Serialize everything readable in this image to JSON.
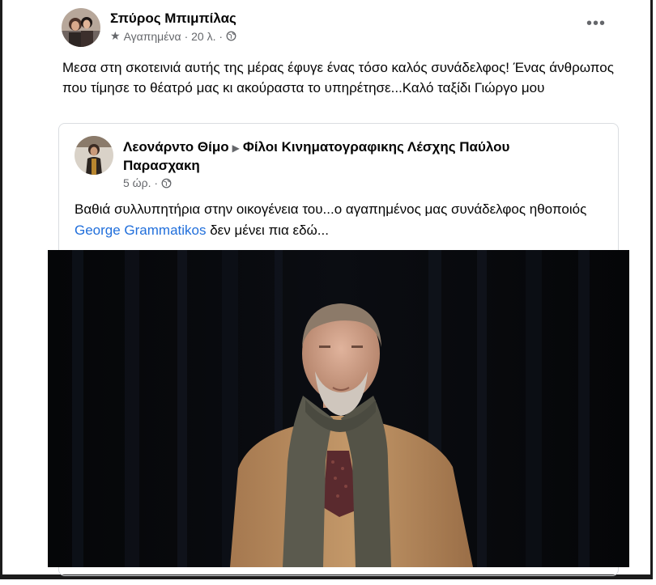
{
  "post": {
    "author": "Σπύρος Μπιμπίλας",
    "audience": "Αγαπημένα",
    "time": "· 20 λ. ·",
    "more_label": "•••",
    "text": "Μεσα στη σκοτεινιά αυτής της μέρας έφυγε ένας τόσο καλός συνάδελφος! Ένας άνθρωπος που τίμησε το θέατρό μας  κι ακούραστα το υπηρέτησε...Καλό ταξίδι Γιώργο μου"
  },
  "shared": {
    "author": "Λεονάρντο Θίμο",
    "group": "Φίλοι Κινηματογραφικης Λέσχης Παύλου Παρασχακη",
    "time": "5 ώρ. ·",
    "text_before": "Βαθιά συλλυπητήρια στην οικογένεια του...ο αγαπημένος μας συνάδελφος ηθοποιός ",
    "tag": "George Grammatikos",
    "text_after": " δεν μένει πια εδώ..."
  },
  "icons": {
    "star": "star-icon",
    "globe": "globe-icon",
    "arrow": "triangle-right-icon"
  },
  "colors": {
    "link": "#216fdb",
    "meta": "#65676b"
  }
}
